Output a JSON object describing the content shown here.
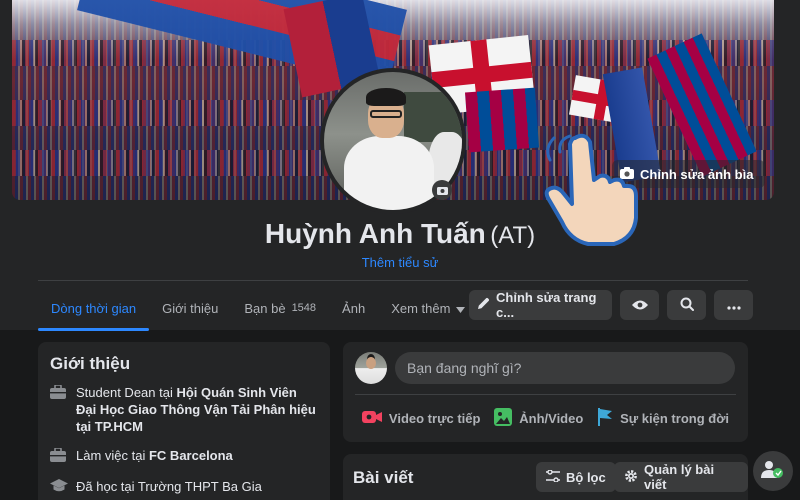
{
  "profile": {
    "name": "Huỳnh Anh Tuấn",
    "nickname": "(AT)",
    "add_bio_label": "Thêm tiểu sử",
    "edit_cover_label": "Chỉnh sửa ảnh bìa"
  },
  "nav": {
    "tabs": [
      {
        "label": "Dòng thời gian"
      },
      {
        "label": "Giới thiệu"
      },
      {
        "label": "Bạn bè",
        "count": "1548"
      },
      {
        "label": "Ảnh"
      },
      {
        "label": "Xem thêm"
      }
    ],
    "edit_profile_label": "Chỉnh sửa trang c..."
  },
  "intro": {
    "title": "Giới thiệu",
    "items": [
      {
        "prefix": "Student Dean tại ",
        "bold": "Hội Quán Sinh Viên Đại Học Giao Thông Vận Tải Phân hiệu tại TP.HCM"
      },
      {
        "prefix": "Làm việc tại ",
        "bold": "FC Barcelona"
      },
      {
        "prefix": "Đã học tại Trường THPT Ba Gia",
        "bold": ""
      }
    ]
  },
  "composer": {
    "placeholder": "Bạn đang nghĩ gì?",
    "live_label": "Video trực tiếp",
    "photo_label": "Ảnh/Video",
    "event_label": "Sự kiện trong đời"
  },
  "posts": {
    "title": "Bài viết",
    "filter_label": "Bộ lọc",
    "manage_label": "Quản lý bài viết"
  },
  "colors": {
    "accent": "#2d88ff",
    "background": "#18191a",
    "card": "#242526",
    "button": "#3a3b3c"
  }
}
